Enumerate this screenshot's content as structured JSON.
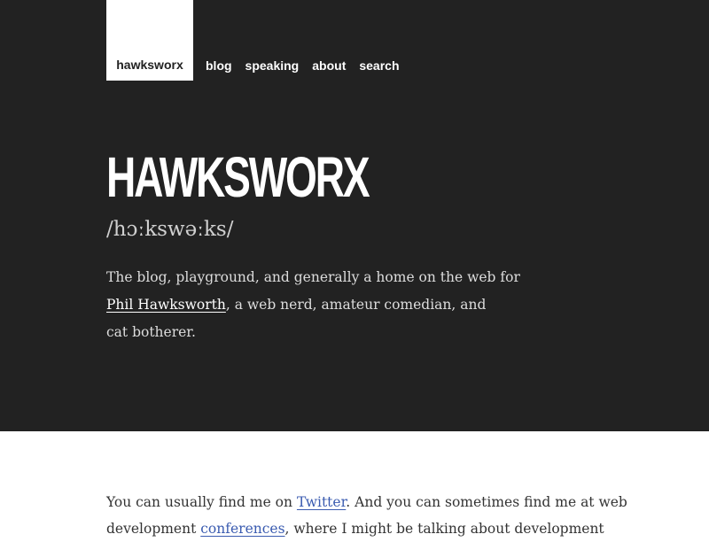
{
  "header": {
    "brand": "hawksworx",
    "nav": [
      {
        "label": "blog"
      },
      {
        "label": "speaking"
      },
      {
        "label": "about"
      },
      {
        "label": "search"
      }
    ]
  },
  "hero": {
    "title": "HAWKSWORX",
    "pronunciation": "/hɔːkswəːks/",
    "intro": {
      "text_before_link": "The blog, playground, and generally a home on the web for",
      "link_text": "Phil Hawksworth",
      "text_after_link": ", a web nerd, amateur comedian, and",
      "last_line": "cat botherer."
    }
  },
  "content": {
    "line1_before": "You can usually find me on ",
    "twitter_link": "Twitter",
    "line1_after": ". And you can sometimes find me at web",
    "line2_before": "development ",
    "conferences_link": "conferences",
    "line2_after": ", where I might be talking about development"
  }
}
